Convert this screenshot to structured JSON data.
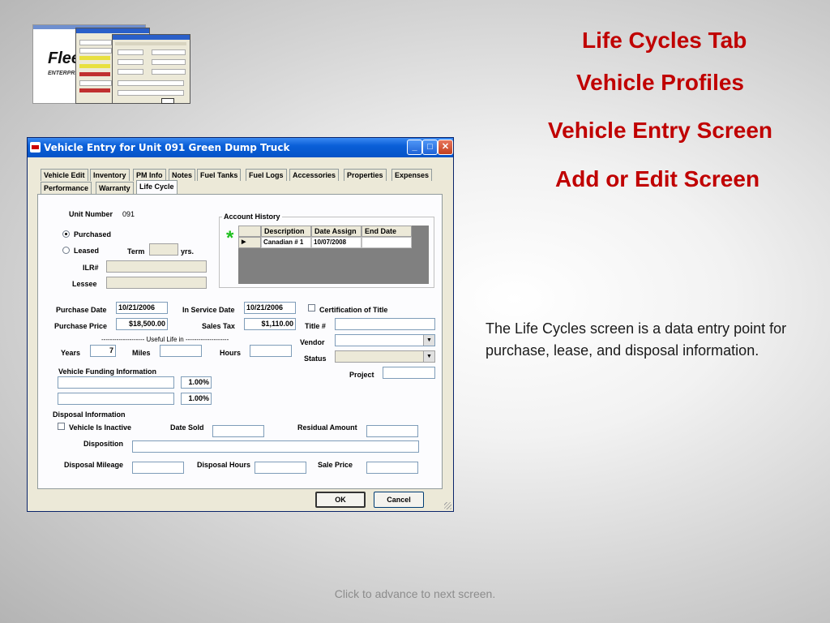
{
  "slide": {
    "headings": [
      "Life Cycles Tab",
      "Vehicle Profiles",
      "Vehicle Entry Screen",
      "Add or Edit Screen"
    ],
    "description": "The Life Cycles screen is a data entry point for purchase, lease, and disposal information.",
    "footer": "Click to advance to next screen.",
    "logo_text": "Flee",
    "logo_sub": "ENTERPRIS"
  },
  "window": {
    "title": "Vehicle Entry for Unit 091 Green Dump Truck",
    "controls": {
      "minimize": "_",
      "maximize": "□",
      "close": "✕"
    },
    "tabs_row1": [
      "Vehicle Edit",
      "Inventory",
      "PM Info",
      "Notes",
      "Fuel Tanks",
      "Fuel Logs",
      "Accessories",
      "Properties",
      "Expenses"
    ],
    "tabs_row2": [
      "Performance",
      "Warranty",
      "Life Cycle"
    ],
    "active_tab": "Life Cycle"
  },
  "form": {
    "unit_number_label": "Unit Number",
    "unit_number_value": "091",
    "purchased_label": "Purchased",
    "leased_label": "Leased",
    "term_label": "Term",
    "yrs_label": "yrs.",
    "ilr_label": "ILR#",
    "lessee_label": "Lessee",
    "account_history": {
      "title": "Account History",
      "columns": [
        "Description",
        "Date Assign",
        "End Date"
      ],
      "rows": [
        [
          "Canadian # 1",
          "10/07/2008",
          ""
        ]
      ],
      "new_row_marker": "*"
    },
    "purchase_date_label": "Purchase Date",
    "purchase_date": "10/21/2006",
    "in_service_date_label": "In Service Date",
    "in_service_date": "10/21/2006",
    "certification_label": "Certification of Title",
    "purchase_price_label": "Purchase Price",
    "purchase_price": "$18,500.00",
    "sales_tax_label": "Sales Tax",
    "sales_tax": "$1,110.00",
    "title_no_label": "Title #",
    "useful_life_label": "--------------------  Useful Life in  --------------------",
    "years_label": "Years",
    "years_value": "7",
    "miles_label": "Miles",
    "hours_label": "Hours",
    "vendor_label": "Vendor",
    "status_label": "Status",
    "funding_label": "Vehicle Funding Information",
    "funding_pct_1": "1.00%",
    "funding_pct_2": "1.00%",
    "project_label": "Project",
    "disposal_info_label": "Disposal Information",
    "inactive_label": "Vehicle Is Inactive",
    "date_sold_label": "Date Sold",
    "residual_amount_label": "Residual Amount",
    "disposition_label": "Disposition",
    "disposal_mileage_label": "Disposal Mileage",
    "disposal_hours_label": "Disposal Hours",
    "sale_price_label": "Sale Price",
    "ok_label": "OK",
    "cancel_label": "Cancel"
  }
}
